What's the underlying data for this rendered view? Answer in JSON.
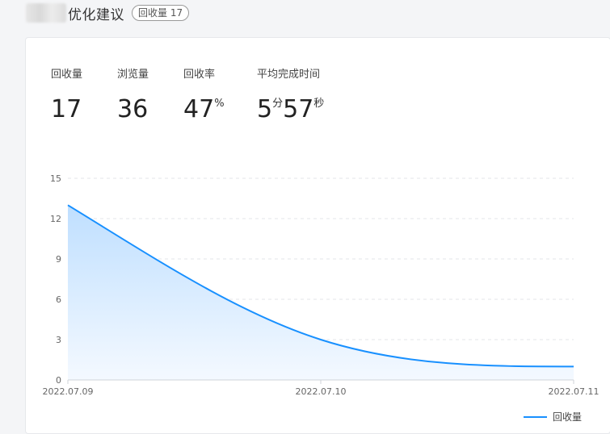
{
  "header": {
    "title": "优化建议",
    "badge": "回收量 17"
  },
  "stats": [
    {
      "label": "回收量",
      "value": "17"
    },
    {
      "label": "浏览量",
      "value": "36"
    },
    {
      "label": "回收率",
      "value": "47",
      "unit": "%"
    },
    {
      "label": "平均完成时间",
      "minutes": "5",
      "min_unit": "分",
      "seconds": "57",
      "sec_unit": "秒"
    }
  ],
  "chart_data": {
    "type": "area",
    "x": [
      "2022.07.09",
      "2022.07.10",
      "2022.07.11"
    ],
    "series": [
      {
        "name": "回收量",
        "values": [
          13,
          3,
          1
        ]
      }
    ],
    "y_ticks": [
      "0",
      "3",
      "6",
      "9",
      "12",
      "15"
    ],
    "ylim": [
      0,
      15
    ],
    "grid": true,
    "legend": "bottom-right",
    "colors": {
      "line": "#1890ff",
      "fill_top": "#bfdfff",
      "fill_bottom": "#f4f9ff",
      "grid": "#e3e6ea",
      "axis": "#cfd3d8"
    }
  }
}
